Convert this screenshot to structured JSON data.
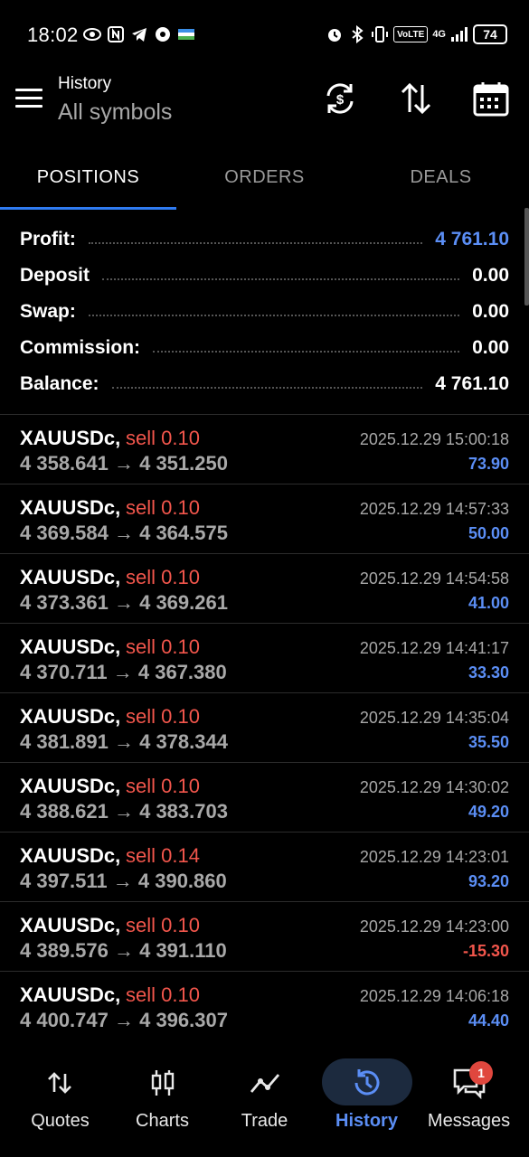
{
  "status_bar": {
    "time": "18:02",
    "battery": "74",
    "volte": "VoLTE",
    "network": "4G"
  },
  "header": {
    "title": "History",
    "subtitle": "All symbols",
    "icons": [
      "menu-icon",
      "refresh-currency-icon",
      "sort-icon",
      "calendar-icon"
    ]
  },
  "tabs": [
    {
      "label": "POSITIONS",
      "active": true
    },
    {
      "label": "ORDERS",
      "active": false
    },
    {
      "label": "DEALS",
      "active": false
    }
  ],
  "summary": {
    "profit": {
      "label": "Profit:",
      "value": "4 761.10"
    },
    "deposit": {
      "label": "Deposit",
      "value": "0.00"
    },
    "swap": {
      "label": "Swap:",
      "value": "0.00"
    },
    "commission": {
      "label": "Commission:",
      "value": "0.00"
    },
    "balance": {
      "label": "Balance:",
      "value": "4 761.10"
    }
  },
  "deals": [
    {
      "symbol": "XAUUSDc,",
      "side": "sell 0.10",
      "prices": "4 358.641 → 4 351.250",
      "time": "2025.12.29 15:00:18",
      "profit": "73.90",
      "profit_sign": "pos"
    },
    {
      "symbol": "XAUUSDc,",
      "side": "sell 0.10",
      "prices": "4 369.584 → 4 364.575",
      "time": "2025.12.29 14:57:33",
      "profit": "50.00",
      "profit_sign": "pos"
    },
    {
      "symbol": "XAUUSDc,",
      "side": "sell 0.10",
      "prices": "4 373.361 → 4 369.261",
      "time": "2025.12.29 14:54:58",
      "profit": "41.00",
      "profit_sign": "pos"
    },
    {
      "symbol": "XAUUSDc,",
      "side": "sell 0.10",
      "prices": "4 370.711 → 4 367.380",
      "time": "2025.12.29 14:41:17",
      "profit": "33.30",
      "profit_sign": "pos"
    },
    {
      "symbol": "XAUUSDc,",
      "side": "sell 0.10",
      "prices": "4 381.891 → 4 378.344",
      "time": "2025.12.29 14:35:04",
      "profit": "35.50",
      "profit_sign": "pos"
    },
    {
      "symbol": "XAUUSDc,",
      "side": "sell 0.10",
      "prices": "4 388.621 → 4 383.703",
      "time": "2025.12.29 14:30:02",
      "profit": "49.20",
      "profit_sign": "pos"
    },
    {
      "symbol": "XAUUSDc,",
      "side": "sell 0.14",
      "prices": "4 397.511 → 4 390.860",
      "time": "2025.12.29 14:23:01",
      "profit": "93.20",
      "profit_sign": "pos"
    },
    {
      "symbol": "XAUUSDc,",
      "side": "sell 0.10",
      "prices": "4 389.576 → 4 391.110",
      "time": "2025.12.29 14:23:00",
      "profit": "-15.30",
      "profit_sign": "neg"
    },
    {
      "symbol": "XAUUSDc,",
      "side": "sell 0.10",
      "prices": "4 400.747 → 4 396.307",
      "time": "2025.12.29 14:06:18",
      "profit": "44.40",
      "profit_sign": "pos"
    }
  ],
  "bottom_nav": [
    {
      "label": "Quotes",
      "icon": "quotes-icon",
      "active": false
    },
    {
      "label": "Charts",
      "icon": "charts-icon",
      "active": false
    },
    {
      "label": "Trade",
      "icon": "trade-icon",
      "active": false
    },
    {
      "label": "History",
      "icon": "history-icon",
      "active": true
    },
    {
      "label": "Messages",
      "icon": "messages-icon",
      "active": false
    }
  ],
  "messages_badge": "1",
  "colors": {
    "accent": "#2f7bf2",
    "profit_positive": "#5b8ef5",
    "profit_negative": "#f2564c",
    "sell": "#f2564c",
    "background": "#000000"
  }
}
